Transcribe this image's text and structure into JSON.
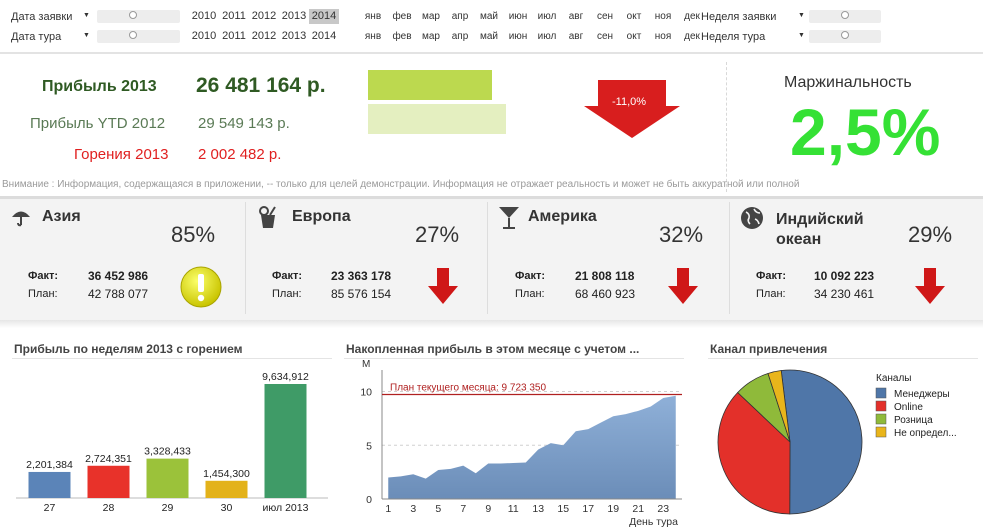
{
  "filters": {
    "rows": [
      {
        "label": "Дата заявки",
        "right_label": "Неделя заявки"
      },
      {
        "label": "Дата тура",
        "right_label": "Неделя тура"
      }
    ],
    "years": [
      "2010",
      "2011",
      "2012",
      "2013",
      "2014"
    ],
    "selected_year": "2014",
    "months": [
      "янв",
      "фев",
      "мар",
      "апр",
      "май",
      "июн",
      "июл",
      "авг",
      "сен",
      "окт",
      "ноя",
      "дек"
    ]
  },
  "kpi": {
    "profit_label": "Прибыль 2013",
    "profit_value": "26 481 164 р.",
    "ytd_label": "Прибыль YTD 2012",
    "ytd_value": "29 549 143 р.",
    "burn_label": "Горения 2013",
    "burn_value": "2 002 482 р.",
    "change": "-11,0%",
    "bar_fill_profit": 0.8962,
    "bar_fill_ytd": 1.0,
    "margin_label": "Маржинальность",
    "margin_value": "2,5%",
    "notice": "Внимание : Информация, содержащаяся в приложении, -- только для целей демонстрации.  Информация не отражает реальность и может не быть аккуратной или полной"
  },
  "regions": [
    {
      "name": "Азия",
      "pct": "85%",
      "fact_label": "Факт:",
      "fact": "36 452 986",
      "plan_label": "План:",
      "plan": "42 788 077",
      "icon": "umbrella-icon",
      "status": "warning"
    },
    {
      "name": "Европа",
      "pct": "27%",
      "fact_label": "Факт:",
      "fact": "23 363 178",
      "plan_label": "План:",
      "plan": "85 576 154",
      "icon": "drink-icon",
      "status": "down"
    },
    {
      "name": "Америка",
      "pct": "32%",
      "fact_label": "Факт:",
      "fact": "21 808 118",
      "plan_label": "План:",
      "plan": "68 460 923",
      "icon": "cocktail-icon",
      "status": "down"
    },
    {
      "name": "Индийский океан",
      "name_line1": "Индийский",
      "name_line2": "океан",
      "pct": "29%",
      "fact_label": "Факт:",
      "fact": "10 092 223",
      "plan_label": "План:",
      "plan": "34 230 461",
      "icon": "globe-icon",
      "status": "down"
    }
  ],
  "charts": {
    "weekly_title": "Прибыль по неделям 2013 с горением",
    "cumulative_title": "Накопленная прибыль в этом месяце с учетом ...",
    "channel_title": "Канал привлечения"
  },
  "chart_data": [
    {
      "type": "bar",
      "title": "Прибыль по неделям 2013 с горением",
      "categories": [
        "27",
        "28",
        "29",
        "30",
        "июл 2013"
      ],
      "values": [
        2201384,
        2724351,
        3328433,
        1454300,
        9634912
      ],
      "value_labels": [
        "2,201,384",
        "2,724,351",
        "3,328,433",
        "1,454,300",
        "9,634,912"
      ],
      "colors": [
        "#5b84b8",
        "#e8322a",
        "#9bc23a",
        "#e3b21a",
        "#3f9b67"
      ]
    },
    {
      "type": "area",
      "title": "Накопленная прибыль в этом месяце с учетом ...",
      "xlabel": "День тура",
      "ylabel": "М",
      "x": [
        1,
        2,
        3,
        4,
        5,
        6,
        7,
        8,
        9,
        10,
        11,
        12,
        13,
        14,
        15,
        16,
        17,
        18,
        19,
        20,
        21,
        22,
        23,
        24
      ],
      "xticks": [
        1,
        3,
        5,
        7,
        9,
        11,
        13,
        15,
        17,
        19,
        21,
        23
      ],
      "y": [
        2.0,
        2.1,
        2.3,
        1.9,
        2.7,
        2.8,
        3.1,
        2.4,
        3.3,
        3.3,
        3.35,
        3.4,
        4.6,
        5.2,
        5.0,
        6.3,
        6.5,
        7.1,
        7.7,
        7.9,
        8.2,
        8.6,
        9.4,
        9.6
      ],
      "ylim": [
        0,
        12
      ],
      "yticks": [
        0,
        5,
        10
      ],
      "plan_line": 9.72335,
      "plan_label": "План текущего месяца: 9 723 350",
      "fill": "#6b8db8"
    },
    {
      "type": "pie",
      "title": "Канал привлечения",
      "legend_title": "Каналы",
      "legend_position": "right",
      "labels": [
        "Менеджеры",
        "Online",
        "Розница",
        "Не определ..."
      ],
      "values": [
        52,
        37,
        8,
        3
      ],
      "colors": [
        "#4f76a8",
        "#e3302a",
        "#8fba3a",
        "#e9b51b"
      ]
    }
  ]
}
